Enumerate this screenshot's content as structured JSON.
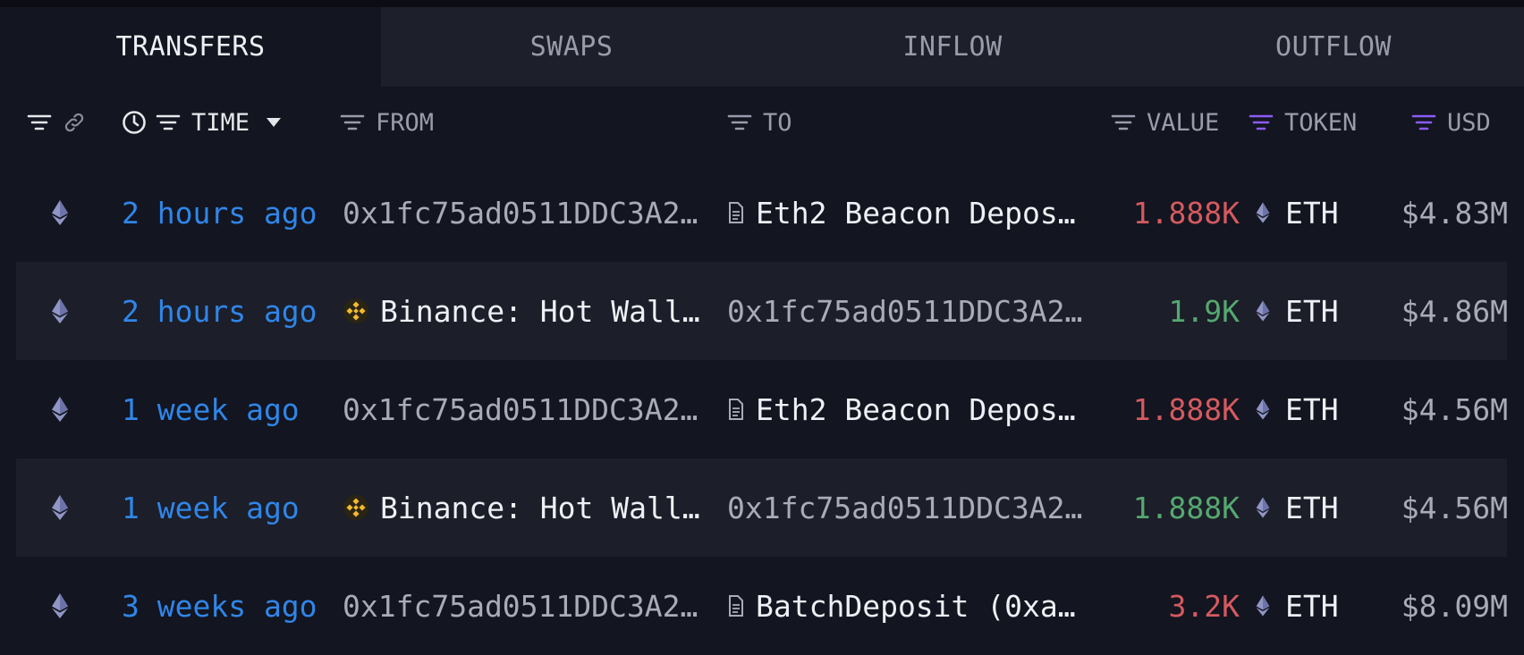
{
  "tabs": [
    {
      "label": "TRANSFERS",
      "active": true
    },
    {
      "label": "SWAPS",
      "active": false
    },
    {
      "label": "INFLOW",
      "active": false
    },
    {
      "label": "OUTFLOW",
      "active": false
    }
  ],
  "columns": {
    "time": "TIME",
    "from": "FROM",
    "to": "TO",
    "value": "VALUE",
    "token": "TOKEN",
    "usd": "USD"
  },
  "colors": {
    "background": "#131520",
    "time_link": "#2f86e8",
    "negative": "#d45a5f",
    "positive": "#55a870",
    "token_filter_accent": "#8b5cf6",
    "binance": "#f3ba2f"
  },
  "rows": [
    {
      "time": "2 hours ago",
      "from": "0x1fc75ad0511DDC3A2…",
      "from_icon": "",
      "to": "Eth2 Beacon Depos…",
      "to_icon": "contract-icon",
      "value": "1.888K",
      "direction": "out",
      "token": "ETH",
      "usd": "$4.83M"
    },
    {
      "time": "2 hours ago",
      "from": "Binance: Hot Wall…",
      "from_icon": "binance-icon",
      "to": "0x1fc75ad0511DDC3A2…",
      "to_icon": "",
      "value": "1.9K",
      "direction": "in",
      "token": "ETH",
      "usd": "$4.86M"
    },
    {
      "time": "1 week ago",
      "from": "0x1fc75ad0511DDC3A2…",
      "from_icon": "",
      "to": "Eth2 Beacon Depos…",
      "to_icon": "contract-icon",
      "value": "1.888K",
      "direction": "out",
      "token": "ETH",
      "usd": "$4.56M"
    },
    {
      "time": "1 week ago",
      "from": "Binance: Hot Wall…",
      "from_icon": "binance-icon",
      "to": "0x1fc75ad0511DDC3A2…",
      "to_icon": "",
      "value": "1.888K",
      "direction": "in",
      "token": "ETH",
      "usd": "$4.56M"
    },
    {
      "time": "3 weeks ago",
      "from": "0x1fc75ad0511DDC3A2…",
      "from_icon": "",
      "to": "BatchDeposit (0xa…",
      "to_icon": "contract-icon",
      "value": "3.2K",
      "direction": "out",
      "token": "ETH",
      "usd": "$8.09M"
    }
  ]
}
